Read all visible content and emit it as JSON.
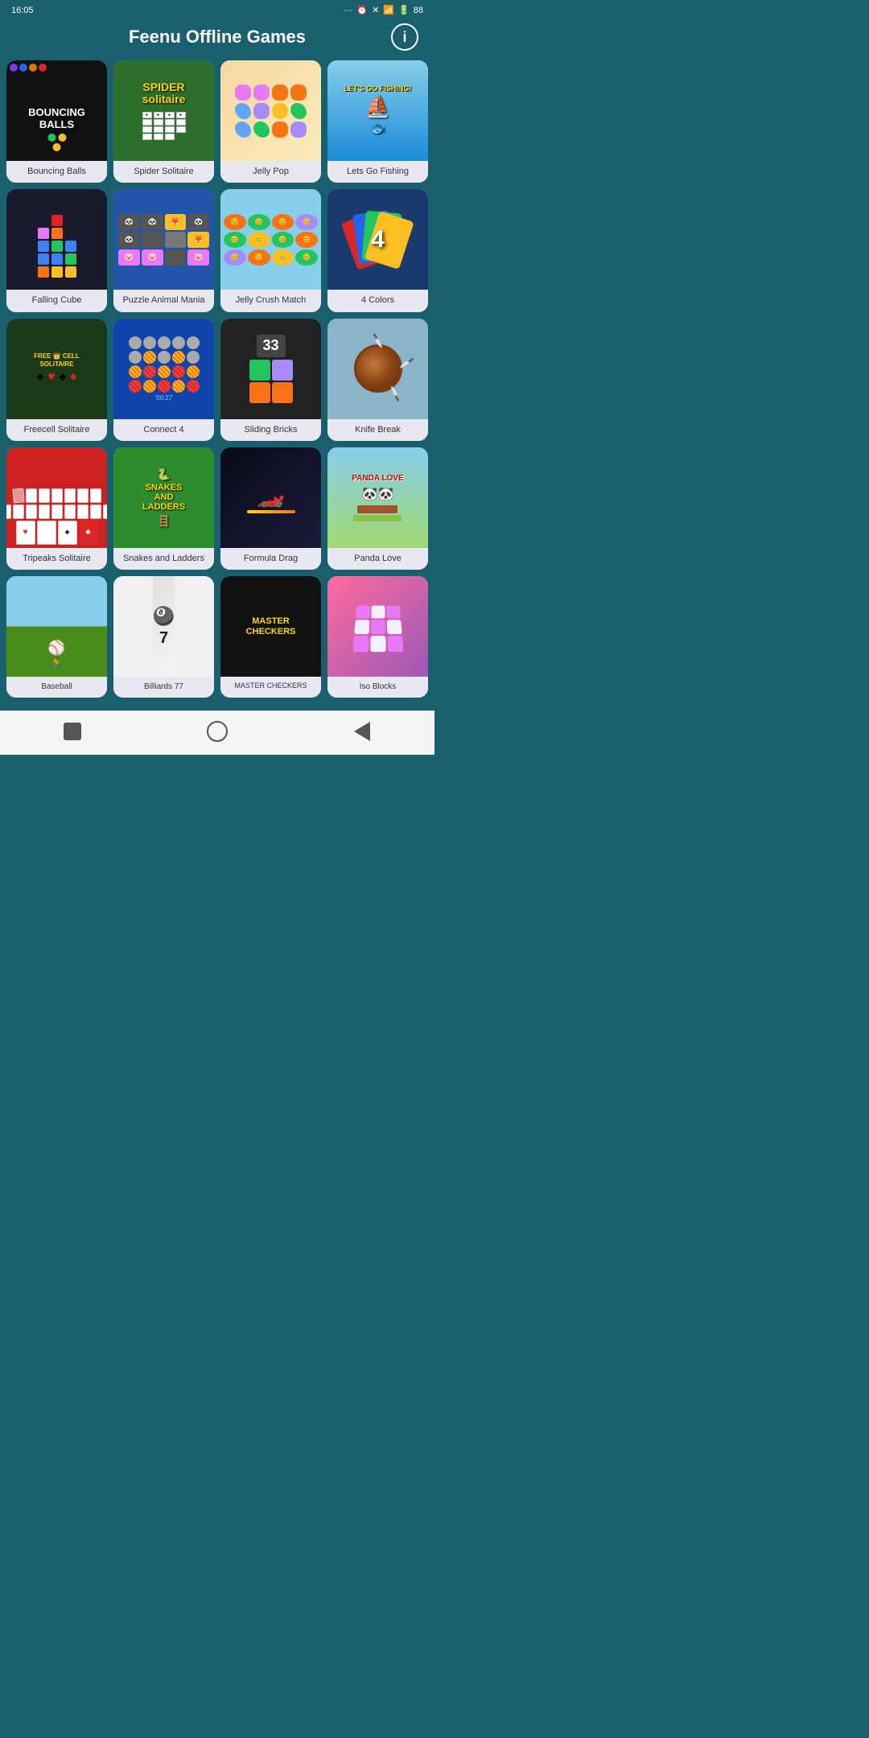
{
  "status": {
    "time": "16:05",
    "battery": "88"
  },
  "header": {
    "title": "Feenu Offline Games",
    "info_label": "i"
  },
  "games": [
    {
      "id": "bouncing-balls",
      "label": "Bouncing Balls",
      "theme": "dark"
    },
    {
      "id": "spider-solitaire",
      "label": "Spider Solitaire",
      "theme": "green"
    },
    {
      "id": "jelly-pop",
      "label": "Jelly Pop",
      "theme": "warm"
    },
    {
      "id": "lets-go-fishing",
      "label": "Lets Go Fishing",
      "theme": "blue"
    },
    {
      "id": "falling-cube",
      "label": "Falling Cube",
      "theme": "dark"
    },
    {
      "id": "puzzle-animal-mania",
      "label": "Puzzle Animal Mania",
      "theme": "blue"
    },
    {
      "id": "jelly-crush-match",
      "label": "Jelly Crush Match",
      "theme": "light-blue"
    },
    {
      "id": "4-colors",
      "label": "4 Colors",
      "theme": "dark-blue"
    },
    {
      "id": "freecell-solitaire",
      "label": "Freecell Solitaire",
      "theme": "dark-green"
    },
    {
      "id": "connect-4",
      "label": "Connect 4",
      "theme": "blue"
    },
    {
      "id": "sliding-bricks",
      "label": "Sliding Bricks",
      "theme": "dark"
    },
    {
      "id": "knife-break",
      "label": "Knife Break",
      "theme": "sky"
    },
    {
      "id": "tripeaks-solitaire",
      "label": "Tripeaks Solitaire",
      "theme": "red"
    },
    {
      "id": "snakes-and-ladders",
      "label": "Snakes and Ladders",
      "theme": "green"
    },
    {
      "id": "formula-drag",
      "label": "Formula Drag",
      "theme": "dark"
    },
    {
      "id": "panda-love",
      "label": "Panda Love",
      "theme": "sky"
    },
    {
      "id": "baseball",
      "label": "Baseball",
      "theme": "sky"
    },
    {
      "id": "billiards",
      "label": "Billiards 77",
      "theme": "light"
    },
    {
      "id": "master-checkers",
      "label": "MASTER CHECKERS",
      "theme": "dark"
    },
    {
      "id": "iso-blocks",
      "label": "Iso Blocks",
      "theme": "purple"
    }
  ],
  "nav": {
    "square": "■",
    "circle": "○",
    "back": "◀"
  }
}
